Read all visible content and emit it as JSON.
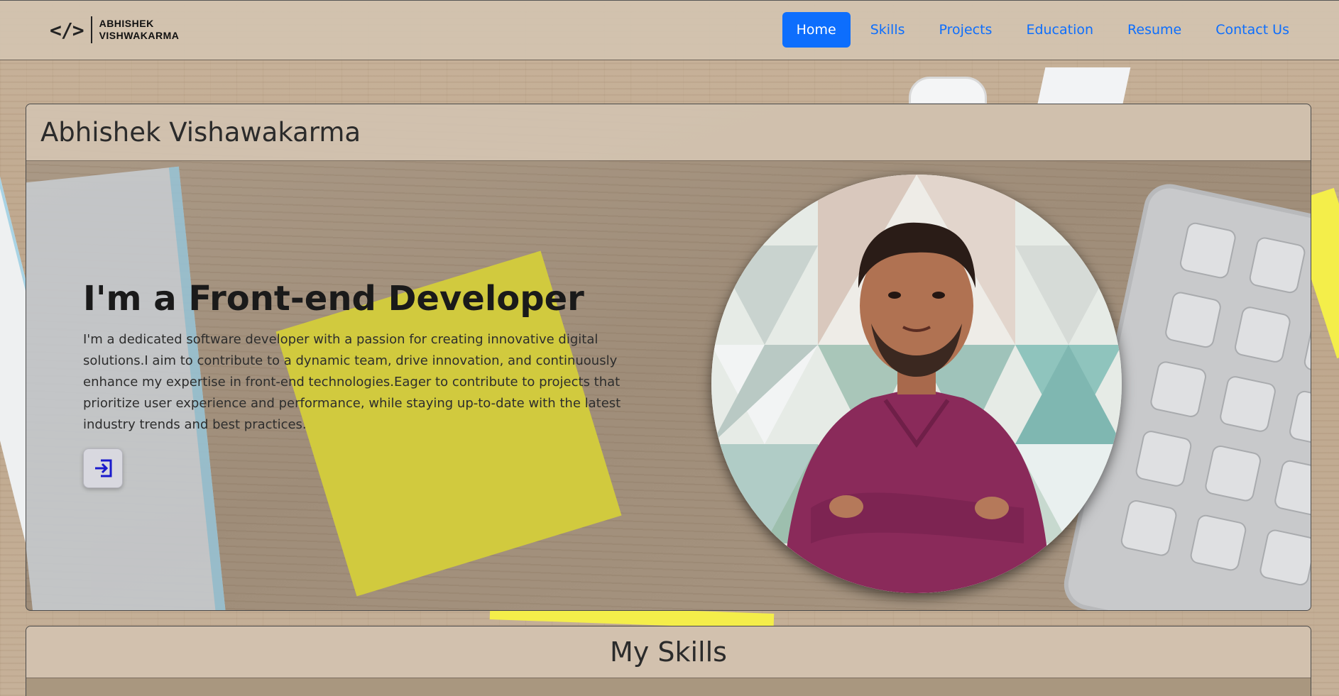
{
  "brand": {
    "icon_text": "</>",
    "line1": "ABHISHEK",
    "line2": "VISHWAKARMA"
  },
  "nav": {
    "items": [
      {
        "label": "Home",
        "active": true
      },
      {
        "label": "Skills",
        "active": false
      },
      {
        "label": "Projects",
        "active": false
      },
      {
        "label": "Education",
        "active": false
      },
      {
        "label": "Resume",
        "active": false
      },
      {
        "label": "Contact Us",
        "active": false
      }
    ]
  },
  "hero": {
    "name": "Abhishek Vishawakarma",
    "title": "I'm a Front-end Developer",
    "description": "I'm a dedicated software developer with a passion for creating innovative digital solutions.I aim to contribute to a dynamic team, drive innovation, and continuously enhance my expertise in front-end technologies.Eager to contribute to projects that prioritize user experience and performance, while staying up-to-date with the latest industry trends and best practices.",
    "button_icon": "login-arrow-icon"
  },
  "skills": {
    "heading": "My Skills"
  },
  "colors": {
    "accent": "#0d6efd",
    "navbar_bg": "#d3c3b0",
    "shirt": "#8a2a5a",
    "sticky_note": "#d4cd3b"
  }
}
